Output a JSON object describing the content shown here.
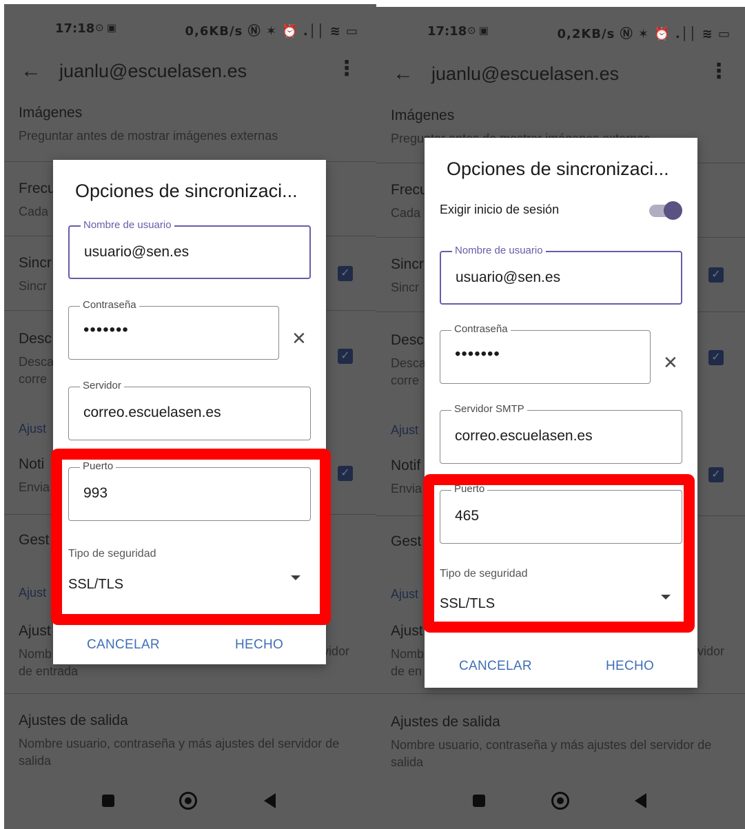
{
  "left": {
    "status": {
      "time": "17:18",
      "time_icons": "⊙ ▣",
      "right": "0,6KB/s Ⓝ ✶ ⏰ .││ ≋ ▭"
    },
    "appbar": {
      "title": "juanlu@escuelasen.es"
    },
    "background": {
      "imagenes_title": "Imágenes",
      "imagenes_sub": "Preguntar antes de mostrar imágenes externas",
      "frec_title": "Frecu",
      "frec_sub": "Cada",
      "sinc_title": "Sincr",
      "sinc_sub": "Sincr",
      "desc_title": "Desc",
      "desc_sub1": "Desca",
      "desc_sub2": "corre",
      "ajustes_sec": "Ajust",
      "noti_title": "Noti",
      "noti_sub": "Envia",
      "gest_title": "Gest",
      "ajustes_sec2": "Ajust",
      "entrada_title": "Ajust",
      "entrada_sub1_left": "Nomb",
      "entrada_sub1_right": "vidor",
      "entrada_sub2": "de entrada",
      "salida_title": "Ajustes de salida",
      "salida_sub": "Nombre usuario, contraseña y más ajustes del servidor de salida"
    },
    "dialog": {
      "title": "Opciones de sincronizaci...",
      "username_label": "Nombre de usuario",
      "username_value": "usuario@sen.es",
      "password_label": "Contraseña",
      "password_value": "•••••••",
      "server_label": "Servidor",
      "server_value": "correo.escuelasen.es",
      "port_label": "Puerto",
      "port_value": "993",
      "security_label": "Tipo de seguridad",
      "security_value": "SSL/TLS",
      "cancel": "CANCELAR",
      "done": "HECHO"
    }
  },
  "right": {
    "status": {
      "time": "17:18",
      "time_icons": "⊙ ▣",
      "right": "0,2KB/s Ⓝ ✶ ⏰ .││ ≋ ▭"
    },
    "appbar": {
      "title": "juanlu@escuelasen.es"
    },
    "background": {
      "imagenes_title": "Imágenes",
      "imagenes_sub": "Preguntar antes de mostrar imágenes externas",
      "frec_title": "Frecu",
      "frec_sub": "Cada",
      "sinc_title": "Sincr",
      "sinc_sub": "Sincr",
      "desc_title": "Desc",
      "desc_sub1": "Desca",
      "desc_sub2": "corre",
      "ajustes_sec": "Ajust",
      "noti_title": "Notif",
      "noti_sub": "Envia",
      "gest_title": "Gest",
      "ajustes_sec2": "Ajust",
      "entrada_title": "Ajust",
      "entrada_sub1_left": "Nomb",
      "entrada_sub1_right": "vidor",
      "entrada_sub2": "de en",
      "salida_title": "Ajustes de salida",
      "salida_sub": "Nombre usuario, contraseña y más ajustes del servidor de salida"
    },
    "dialog": {
      "title": "Opciones de sincronizaci...",
      "require_login_label": "Exigir inicio de sesión",
      "require_login_on": true,
      "username_label": "Nombre de usuario",
      "username_value": "usuario@sen.es",
      "password_label": "Contraseña",
      "password_value": "•••••••",
      "server_label": "Servidor SMTP",
      "server_value": "correo.escuelasen.es",
      "port_label": "Puerto",
      "port_value": "465",
      "security_label": "Tipo de seguridad",
      "security_value": "SSL/TLS",
      "cancel": "CANCELAR",
      "done": "HECHO"
    }
  },
  "colors": {
    "highlight": "#ff0000",
    "accent": "#6b5aa8",
    "button": "#3e6fb5",
    "dim_bg": "#5c5c5c",
    "checkbox": "#1f2b47"
  }
}
